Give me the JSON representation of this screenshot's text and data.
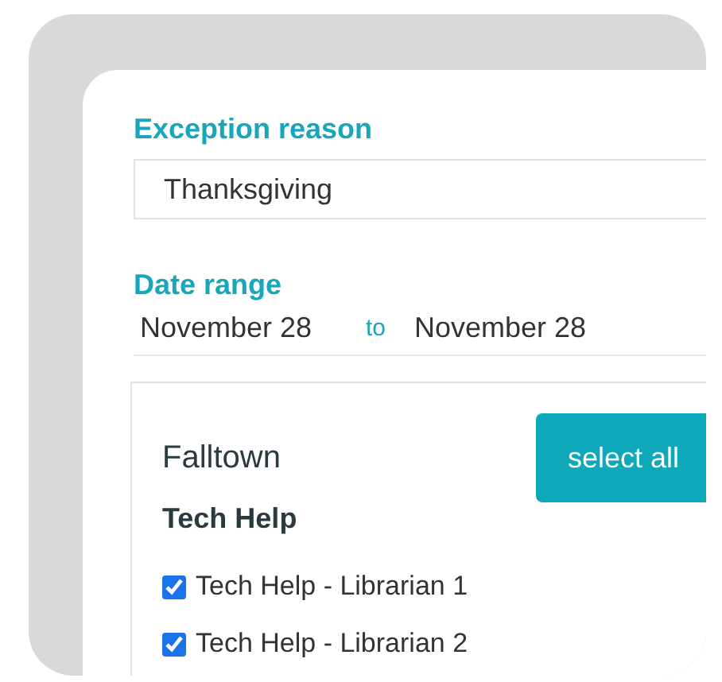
{
  "exception_reason": {
    "label": "Exception reason",
    "value": "Thanksgiving"
  },
  "date_range": {
    "label": "Date range",
    "from": "November 28",
    "separator": "to",
    "to": "November 28"
  },
  "location": {
    "name": "Falltown",
    "button": "select all",
    "group": "Tech Help",
    "items": [
      {
        "label": "Tech Help - Librarian 1",
        "checked": true
      },
      {
        "label": "Tech Help - Librarian 2",
        "checked": true
      }
    ]
  }
}
